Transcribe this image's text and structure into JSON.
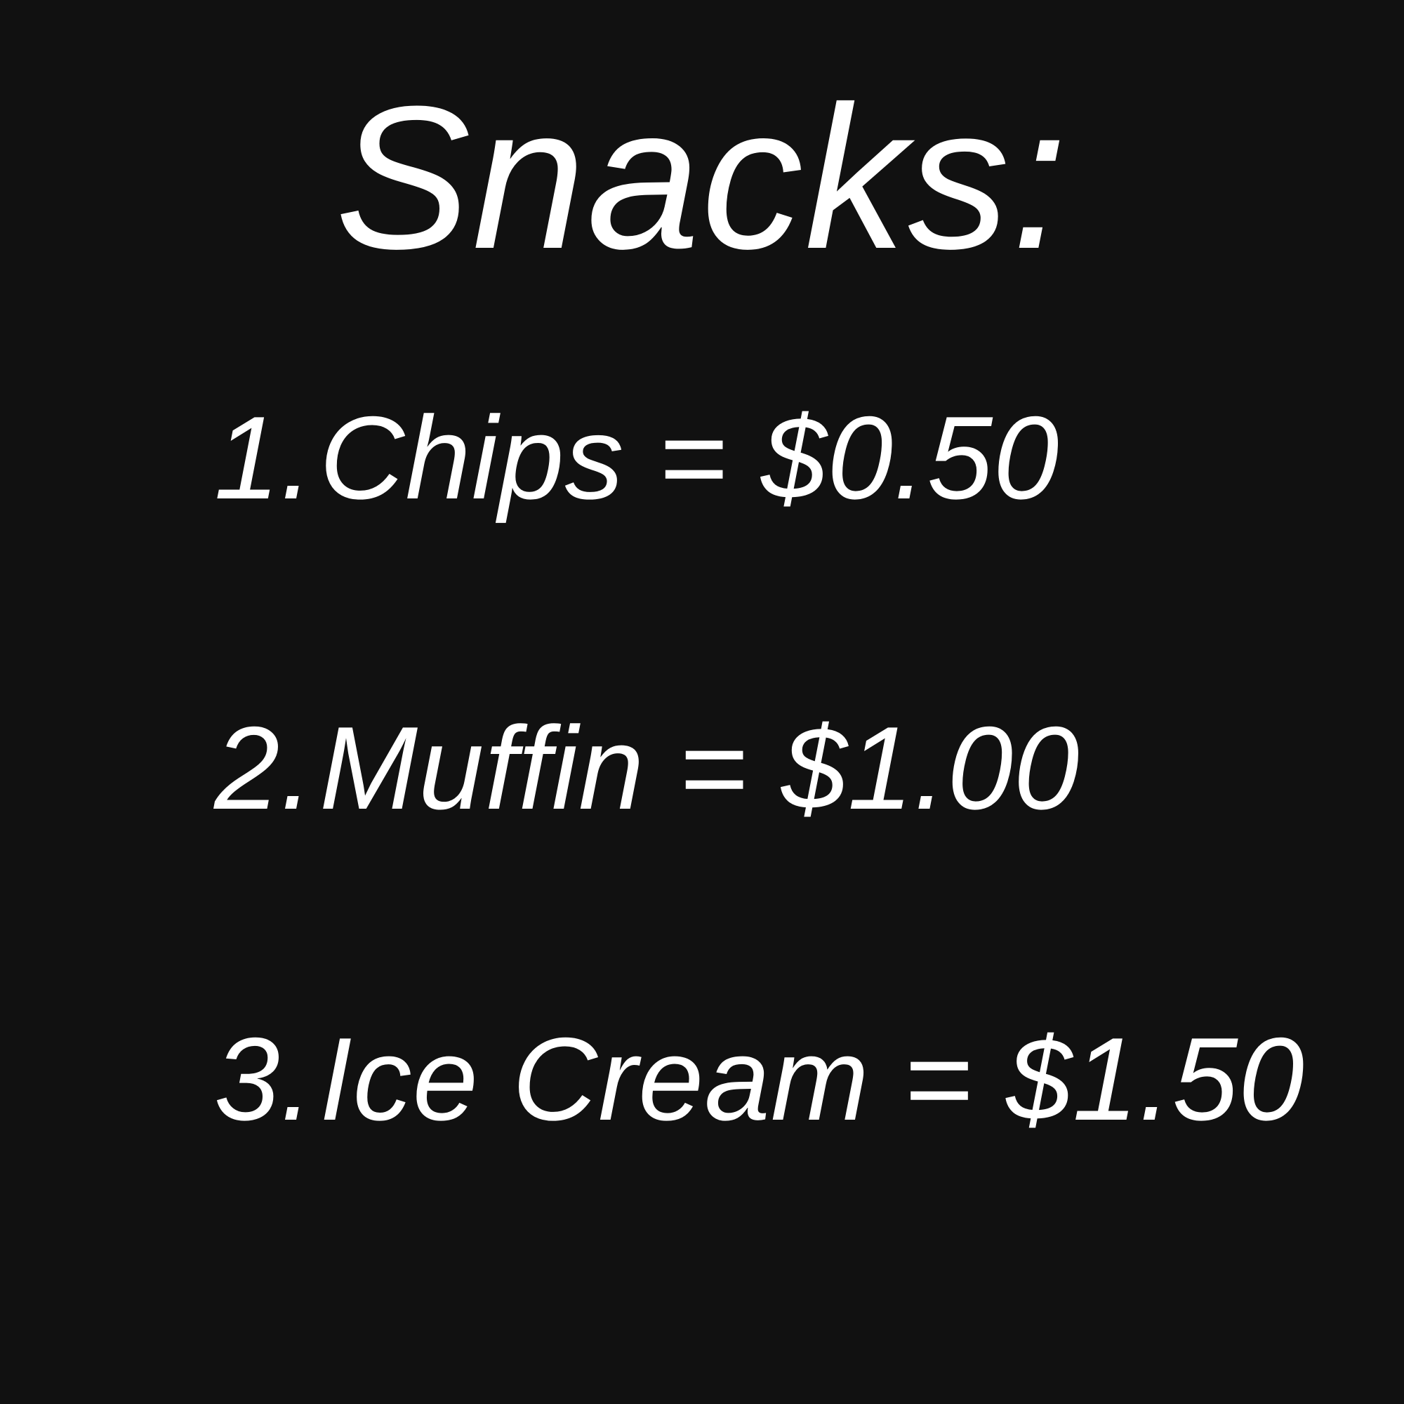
{
  "title": "Snacks:",
  "items": [
    {
      "number": "1.",
      "text": "Chips = $0.50"
    },
    {
      "number": "2.",
      "text": "Muffin = $1.00"
    },
    {
      "number": "3.",
      "text": "Ice Cream = $1.50"
    }
  ],
  "colors": {
    "background": "#111111",
    "text": "#ffffff"
  }
}
